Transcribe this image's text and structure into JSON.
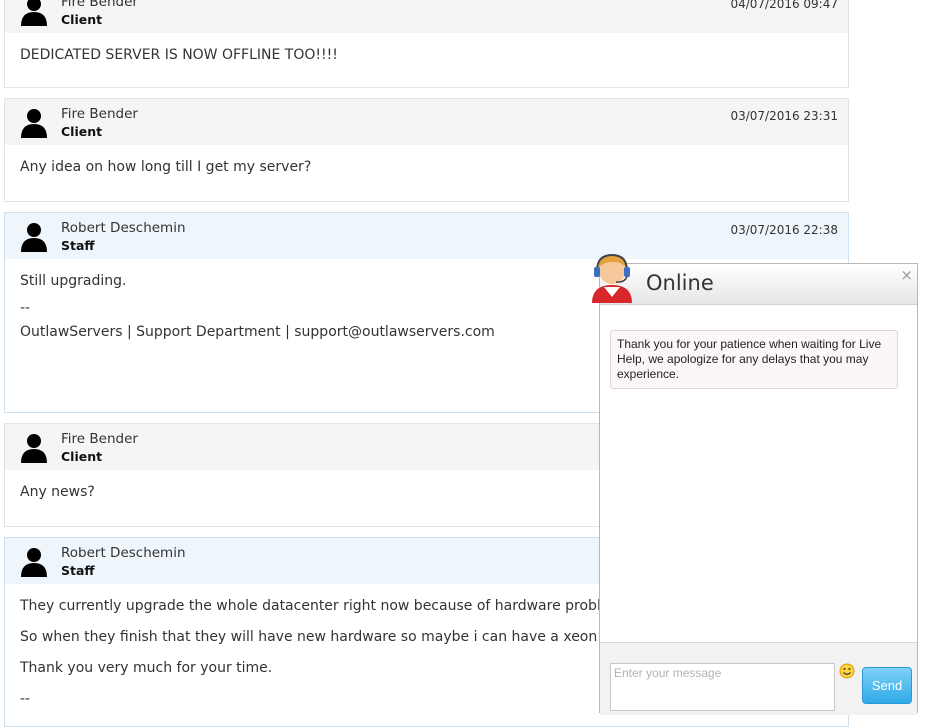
{
  "messages": [
    {
      "author": "Fire Bender",
      "role": "Client",
      "date": "04/07/2016 09:47",
      "body": [
        "DEDICATED SERVER IS NOW OFFLINE TOO!!!!"
      ]
    },
    {
      "author": "Fire Bender",
      "role": "Client",
      "date": "03/07/2016 23:31",
      "body": [
        "Any idea on how long till I get my server?"
      ]
    },
    {
      "author": "Robert Deschemin",
      "role": "Staff",
      "date": "03/07/2016 22:38",
      "body": [
        "Still upgrading."
      ],
      "signature_sep": "--",
      "signature": "OutlawServers | Support Department | support@outlawservers.com"
    },
    {
      "author": "Fire Bender",
      "role": "Client",
      "date": "",
      "body": [
        "Any news?"
      ]
    },
    {
      "author": "Robert Deschemin",
      "role": "Staff",
      "date": "",
      "body": [
        "They currently upgrade the whole datacenter right now because of hardware problem",
        "So when they finish that they will have new hardware so maybe i can have a xeon for y",
        "Thank you very much for your time."
      ],
      "signature_sep": "--"
    }
  ],
  "chat": {
    "title": "Online",
    "close": "×",
    "notice": "Thank you for your patience when waiting for Live Help, we apologize for any delays that you may experience.",
    "input_placeholder": "Enter your message",
    "send_label": "Send"
  },
  "colors": {
    "client_header": "#f5f5f5",
    "staff_header": "#eef6fc",
    "send_button": "#2fa9e8"
  },
  "icons": {
    "avatar": "user-silhouette-icon",
    "operator": "support-operator-headset-icon",
    "emoji": "smiley-emoji-icon"
  }
}
